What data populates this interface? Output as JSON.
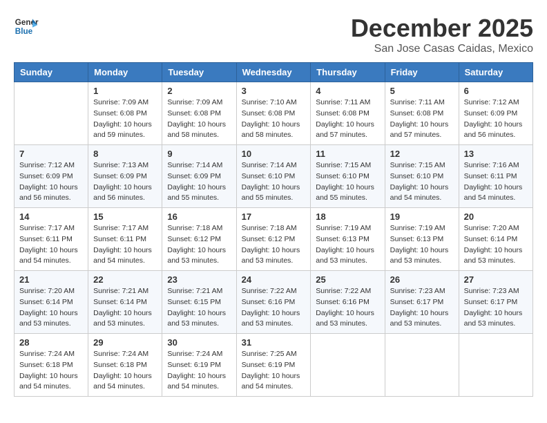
{
  "header": {
    "logo_line1": "General",
    "logo_line2": "Blue",
    "month": "December 2025",
    "location": "San Jose Casas Caidas, Mexico"
  },
  "days_of_week": [
    "Sunday",
    "Monday",
    "Tuesday",
    "Wednesday",
    "Thursday",
    "Friday",
    "Saturday"
  ],
  "weeks": [
    [
      {
        "day": "",
        "info": ""
      },
      {
        "day": "1",
        "info": "Sunrise: 7:09 AM\nSunset: 6:08 PM\nDaylight: 10 hours\nand 59 minutes."
      },
      {
        "day": "2",
        "info": "Sunrise: 7:09 AM\nSunset: 6:08 PM\nDaylight: 10 hours\nand 58 minutes."
      },
      {
        "day": "3",
        "info": "Sunrise: 7:10 AM\nSunset: 6:08 PM\nDaylight: 10 hours\nand 58 minutes."
      },
      {
        "day": "4",
        "info": "Sunrise: 7:11 AM\nSunset: 6:08 PM\nDaylight: 10 hours\nand 57 minutes."
      },
      {
        "day": "5",
        "info": "Sunrise: 7:11 AM\nSunset: 6:08 PM\nDaylight: 10 hours\nand 57 minutes."
      },
      {
        "day": "6",
        "info": "Sunrise: 7:12 AM\nSunset: 6:09 PM\nDaylight: 10 hours\nand 56 minutes."
      }
    ],
    [
      {
        "day": "7",
        "info": "Sunrise: 7:12 AM\nSunset: 6:09 PM\nDaylight: 10 hours\nand 56 minutes."
      },
      {
        "day": "8",
        "info": "Sunrise: 7:13 AM\nSunset: 6:09 PM\nDaylight: 10 hours\nand 56 minutes."
      },
      {
        "day": "9",
        "info": "Sunrise: 7:14 AM\nSunset: 6:09 PM\nDaylight: 10 hours\nand 55 minutes."
      },
      {
        "day": "10",
        "info": "Sunrise: 7:14 AM\nSunset: 6:10 PM\nDaylight: 10 hours\nand 55 minutes."
      },
      {
        "day": "11",
        "info": "Sunrise: 7:15 AM\nSunset: 6:10 PM\nDaylight: 10 hours\nand 55 minutes."
      },
      {
        "day": "12",
        "info": "Sunrise: 7:15 AM\nSunset: 6:10 PM\nDaylight: 10 hours\nand 54 minutes."
      },
      {
        "day": "13",
        "info": "Sunrise: 7:16 AM\nSunset: 6:11 PM\nDaylight: 10 hours\nand 54 minutes."
      }
    ],
    [
      {
        "day": "14",
        "info": "Sunrise: 7:17 AM\nSunset: 6:11 PM\nDaylight: 10 hours\nand 54 minutes."
      },
      {
        "day": "15",
        "info": "Sunrise: 7:17 AM\nSunset: 6:11 PM\nDaylight: 10 hours\nand 54 minutes."
      },
      {
        "day": "16",
        "info": "Sunrise: 7:18 AM\nSunset: 6:12 PM\nDaylight: 10 hours\nand 53 minutes."
      },
      {
        "day": "17",
        "info": "Sunrise: 7:18 AM\nSunset: 6:12 PM\nDaylight: 10 hours\nand 53 minutes."
      },
      {
        "day": "18",
        "info": "Sunrise: 7:19 AM\nSunset: 6:13 PM\nDaylight: 10 hours\nand 53 minutes."
      },
      {
        "day": "19",
        "info": "Sunrise: 7:19 AM\nSunset: 6:13 PM\nDaylight: 10 hours\nand 53 minutes."
      },
      {
        "day": "20",
        "info": "Sunrise: 7:20 AM\nSunset: 6:14 PM\nDaylight: 10 hours\nand 53 minutes."
      }
    ],
    [
      {
        "day": "21",
        "info": "Sunrise: 7:20 AM\nSunset: 6:14 PM\nDaylight: 10 hours\nand 53 minutes."
      },
      {
        "day": "22",
        "info": "Sunrise: 7:21 AM\nSunset: 6:14 PM\nDaylight: 10 hours\nand 53 minutes."
      },
      {
        "day": "23",
        "info": "Sunrise: 7:21 AM\nSunset: 6:15 PM\nDaylight: 10 hours\nand 53 minutes."
      },
      {
        "day": "24",
        "info": "Sunrise: 7:22 AM\nSunset: 6:16 PM\nDaylight: 10 hours\nand 53 minutes."
      },
      {
        "day": "25",
        "info": "Sunrise: 7:22 AM\nSunset: 6:16 PM\nDaylight: 10 hours\nand 53 minutes."
      },
      {
        "day": "26",
        "info": "Sunrise: 7:23 AM\nSunset: 6:17 PM\nDaylight: 10 hours\nand 53 minutes."
      },
      {
        "day": "27",
        "info": "Sunrise: 7:23 AM\nSunset: 6:17 PM\nDaylight: 10 hours\nand 53 minutes."
      }
    ],
    [
      {
        "day": "28",
        "info": "Sunrise: 7:24 AM\nSunset: 6:18 PM\nDaylight: 10 hours\nand 54 minutes."
      },
      {
        "day": "29",
        "info": "Sunrise: 7:24 AM\nSunset: 6:18 PM\nDaylight: 10 hours\nand 54 minutes."
      },
      {
        "day": "30",
        "info": "Sunrise: 7:24 AM\nSunset: 6:19 PM\nDaylight: 10 hours\nand 54 minutes."
      },
      {
        "day": "31",
        "info": "Sunrise: 7:25 AM\nSunset: 6:19 PM\nDaylight: 10 hours\nand 54 minutes."
      },
      {
        "day": "",
        "info": ""
      },
      {
        "day": "",
        "info": ""
      },
      {
        "day": "",
        "info": ""
      }
    ]
  ]
}
